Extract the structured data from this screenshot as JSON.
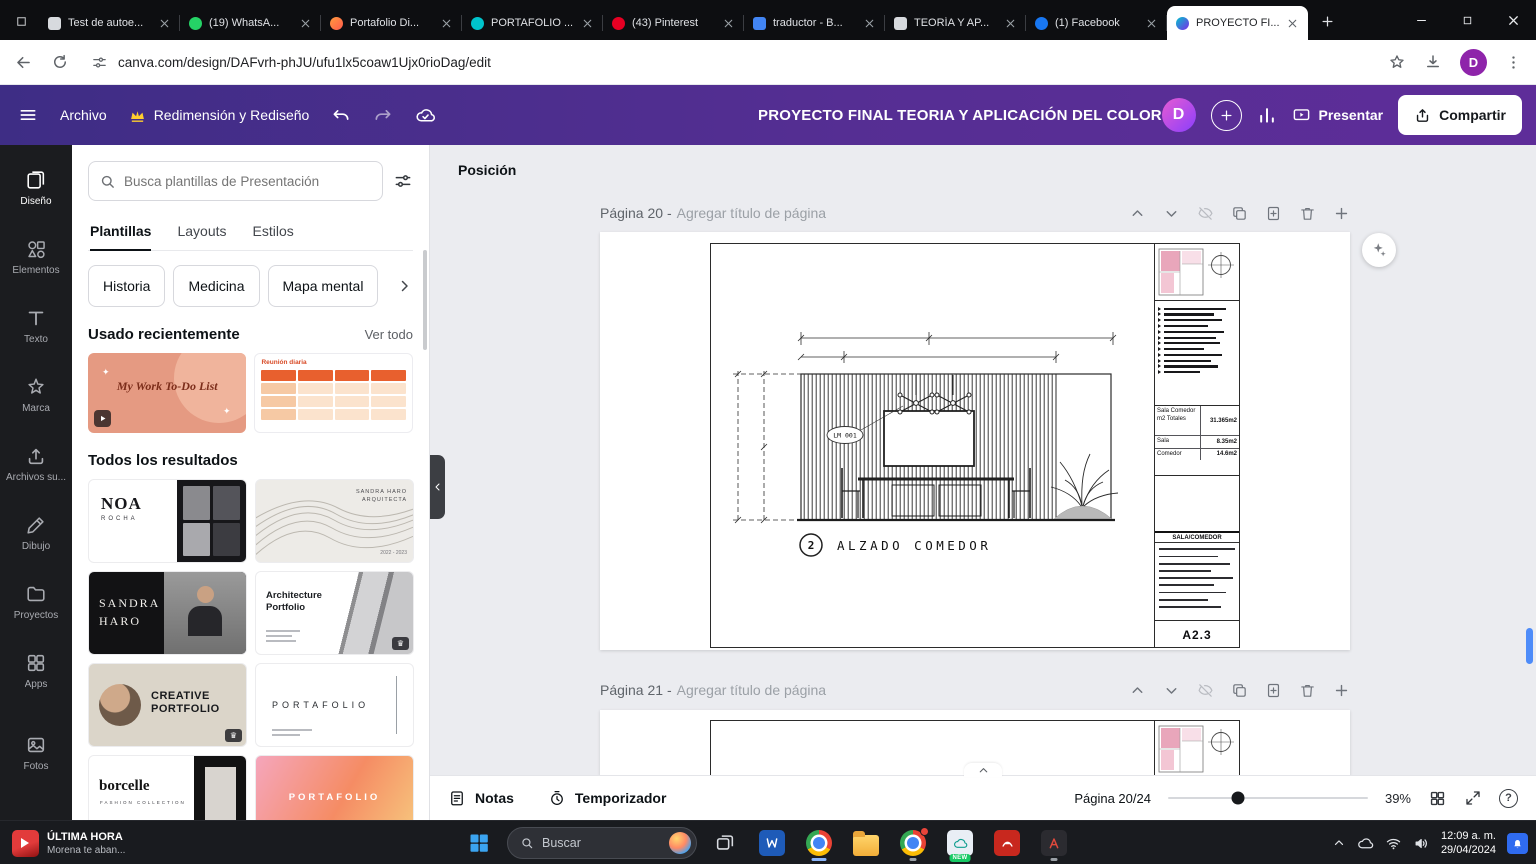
{
  "browser": {
    "tabs": [
      {
        "title": "Test de autoe..."
      },
      {
        "title": "(19) WhatsA..."
      },
      {
        "title": "Portafolio Di..."
      },
      {
        "title": "PORTAFOLIO ..."
      },
      {
        "title": "(43) Pinterest"
      },
      {
        "title": "traductor - B..."
      },
      {
        "title": "TEORÍA Y AP..."
      },
      {
        "title": "(1) Facebook"
      },
      {
        "title": "PROYECTO FI..."
      }
    ],
    "url": "canva.com/design/DAFvrh-phJU/ufu1lx5coaw1Ujx0rioDag/edit",
    "profile_initial": "D"
  },
  "header": {
    "file_menu": "Archivo",
    "resize_label": "Redimensión y Rediseño",
    "doc_title": "PROYECTO FINAL TEORIA Y APLICACIÓN DEL COLOR",
    "avatar_initial": "D",
    "present_label": "Presentar",
    "share_label": "Compartir"
  },
  "rail": {
    "items": [
      "Diseño",
      "Elementos",
      "Texto",
      "Marca",
      "Archivos su...",
      "Dibujo",
      "Proyectos",
      "Apps",
      "Fotos"
    ]
  },
  "panel": {
    "search_placeholder": "Busca plantillas de Presentación",
    "tabs": [
      "Plantillas",
      "Layouts",
      "Estilos"
    ],
    "chips": [
      "Historia",
      "Medicina",
      "Mapa mental"
    ],
    "recent_title": "Usado recientemente",
    "see_all": "Ver todo",
    "recent": [
      {
        "title": "My Work To-Do List"
      },
      {
        "title": "Reunión diaria"
      }
    ],
    "results_title": "Todos los resultados",
    "templates": [
      {
        "line1": "NOA",
        "line2": "ROCHA"
      },
      {
        "line1": "SANDRA HARO",
        "line2": "ARQUITECTA",
        "line3": "2022 - 2023"
      },
      {
        "line1": "SANDRA",
        "line2": "HARO"
      },
      {
        "line1": "Architecture",
        "line2": "Portfolio"
      },
      {
        "line1": "CREATIVE",
        "line2": "PORTFOLIO"
      },
      {
        "line1": "PORTAFOLIO"
      },
      {
        "line1": "borcelle",
        "line2": "FASHION COLLECTION"
      },
      {
        "line1": "PORTAFOLIO"
      }
    ]
  },
  "canvas": {
    "position_label": "Posición",
    "page20_label": "Página 20 -",
    "page21_label": "Página 21 -",
    "page_title_placeholder": "Agregar título de página",
    "drawing": {
      "tag": "LM 001",
      "callout_number": "2",
      "callout_title": "ALZADO COMEDOR",
      "areas": [
        {
          "name": "Sala Comedor m2 Totales",
          "value": "31.365m2"
        },
        {
          "name": "Sala",
          "value": "8.35m2"
        },
        {
          "name": "Comedor",
          "value": "14.6m2"
        }
      ],
      "spec_header": "SALA/COMEDOR",
      "sheet_number": "A2.3"
    }
  },
  "bottombar": {
    "notes": "Notas",
    "timer": "Temporizador",
    "page_indicator": "Página 20/24",
    "zoom": "39%",
    "help": "?"
  },
  "taskbar": {
    "news_line1": "ÚLTIMA HORA",
    "news_line2": "Morena te aban...",
    "search_placeholder": "Buscar",
    "new_badge": "NEW",
    "clock_time": "12:09 a. m.",
    "clock_date": "29/04/2024"
  }
}
